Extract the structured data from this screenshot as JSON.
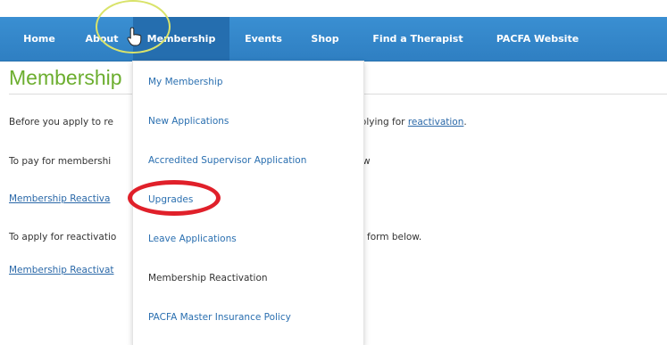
{
  "nav": {
    "items": [
      {
        "label": "Home"
      },
      {
        "label": "About"
      },
      {
        "label": "Membership"
      },
      {
        "label": "Events"
      },
      {
        "label": "Shop"
      },
      {
        "label": "Find a Therapist"
      },
      {
        "label": "PACFA Website"
      }
    ],
    "active_item": "Membership"
  },
  "page": {
    "title": "Membership",
    "paragraphs": [
      {
        "left_text": "Before you apply to re",
        "right_text": "pplying for ",
        "right_link": "reactivation",
        "right_suffix": "."
      },
      {
        "left_text": "To pay for membershi",
        "right_text": "w"
      },
      {
        "left_link": "Membership Reactiva"
      },
      {
        "left_text": "To apply for reactivatio",
        "right_text": "form below."
      },
      {
        "left_link": "Membership Reactivat"
      }
    ]
  },
  "dropdown": {
    "items": [
      {
        "label": "My Membership"
      },
      {
        "label": "New Applications"
      },
      {
        "label": "Accredited Supervisor Application"
      },
      {
        "label": "Upgrades"
      },
      {
        "label": "Leave Applications"
      },
      {
        "label": "Membership Reactivation"
      },
      {
        "label": "PACFA Master Insurance Policy"
      }
    ],
    "highlighted_item": "Upgrades"
  },
  "colors": {
    "nav_bg": "#3a8fd2",
    "title_green": "#6cae2f",
    "link_blue": "#2a6fb0",
    "highlight_red": "#e0202a",
    "highlight_yellow": "#d9e36a"
  },
  "icons": {
    "cursor": "hand-pointer-icon"
  }
}
